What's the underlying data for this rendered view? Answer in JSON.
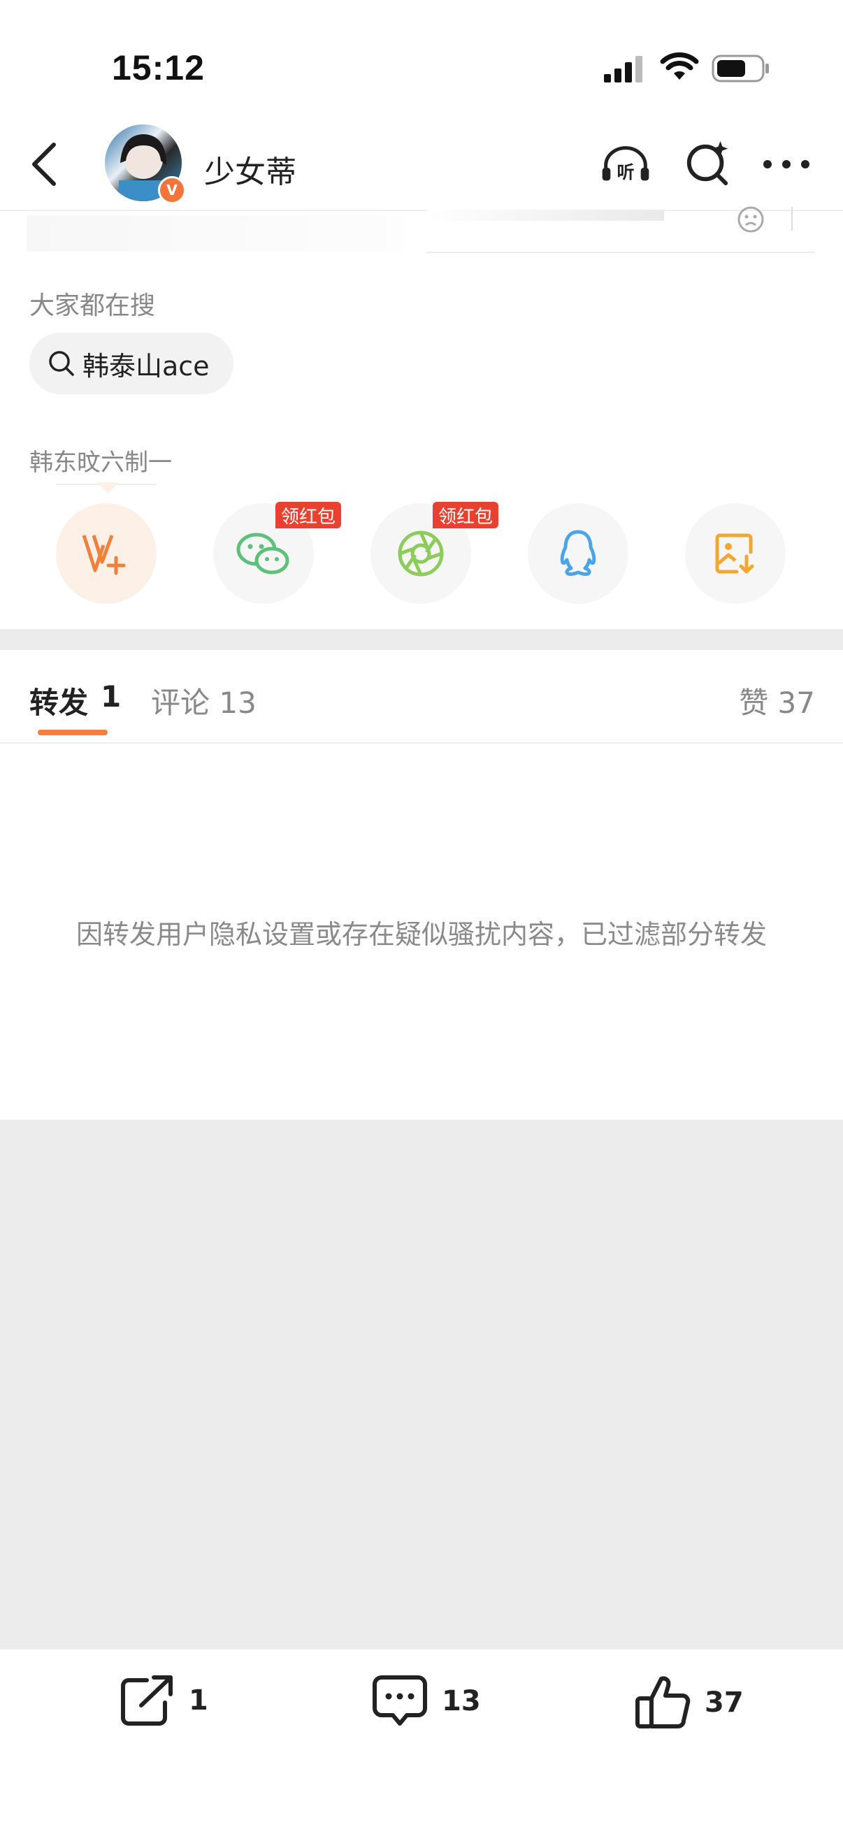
{
  "status_bar": {
    "time": "15:12"
  },
  "nav": {
    "title": "少女蒂",
    "listen_label": "听"
  },
  "search_section": {
    "label": "大家都在搜",
    "chip": "韩泰山ace",
    "hashtag": "韩东旼六制一"
  },
  "share": {
    "badge": "领红包",
    "items": [
      "weibo",
      "wechat",
      "moments",
      "qq",
      "save-image"
    ]
  },
  "tabs": {
    "repost": "转发",
    "repost_count": "1",
    "comment": "评论 13",
    "like": "赞 37"
  },
  "notice": "因转发用户隐私设置或存在疑似骚扰内容，已过滤部分转发",
  "bottom": {
    "repost_count": "1",
    "comment_count": "13",
    "like_count": "37"
  },
  "colors": {
    "accent": "#f0803a",
    "badge": "#e8412f"
  }
}
